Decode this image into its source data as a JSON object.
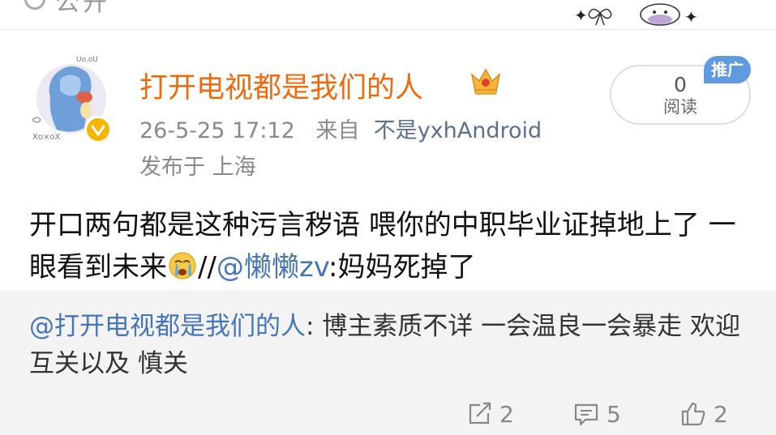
{
  "top": {
    "partial_text": "公开"
  },
  "author": {
    "name": "打开电视都是我们的人",
    "timestamp": "26-5-25 17:12",
    "source_prefix": "来自",
    "source": "不是yxhAndroid",
    "location": "发布于 上海"
  },
  "stats": {
    "read_count": "0",
    "read_label": "阅读",
    "promo_badge": "推广"
  },
  "post": {
    "text": "开口两句都是这种污言秽语 喂你的中职毕业证掉地上了 一眼看到未来",
    "separator": "//",
    "mention": "@懒懒zv",
    "after_mention": ":妈妈死掉了"
  },
  "repost": {
    "mention": "@打开电视都是我们的人",
    "text": ": 博主素质不详 一会温良一会暴走 欢迎互关以及 慎关"
  },
  "actions": {
    "forward_count": "2",
    "comment_count": "5",
    "like_count": "2"
  },
  "colors": {
    "username": "#f0690a",
    "mention": "#4675b8",
    "repost_bg": "#f3f3f3",
    "badge": "#5f9ae0",
    "verified": "#f7b500"
  }
}
